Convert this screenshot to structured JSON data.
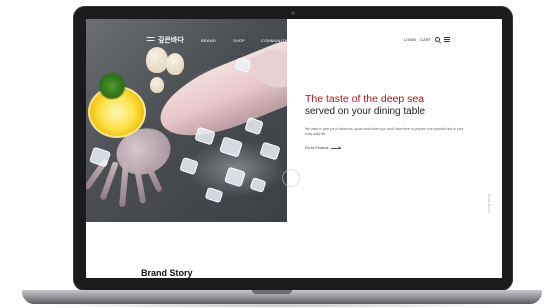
{
  "site": {
    "brand": "깊은바다",
    "nav": [
      "BRAND",
      "SHOP",
      "COMMUNITY"
    ],
    "utility": {
      "login": "LOGIN",
      "cart": "CART"
    }
  },
  "hero": {
    "headline": "The taste of the deep sea",
    "subheadline": "served on your dining table",
    "description": "We want to give you a delicious, quick meal when you don't have time to prepare one yourself due to your busy daily life.",
    "cta": "Go to Product",
    "side_label": "Scroll Down"
  },
  "section": {
    "title": "Brand Story"
  },
  "colors": {
    "accent": "#b0141e",
    "frame": "#1b1b1d"
  }
}
